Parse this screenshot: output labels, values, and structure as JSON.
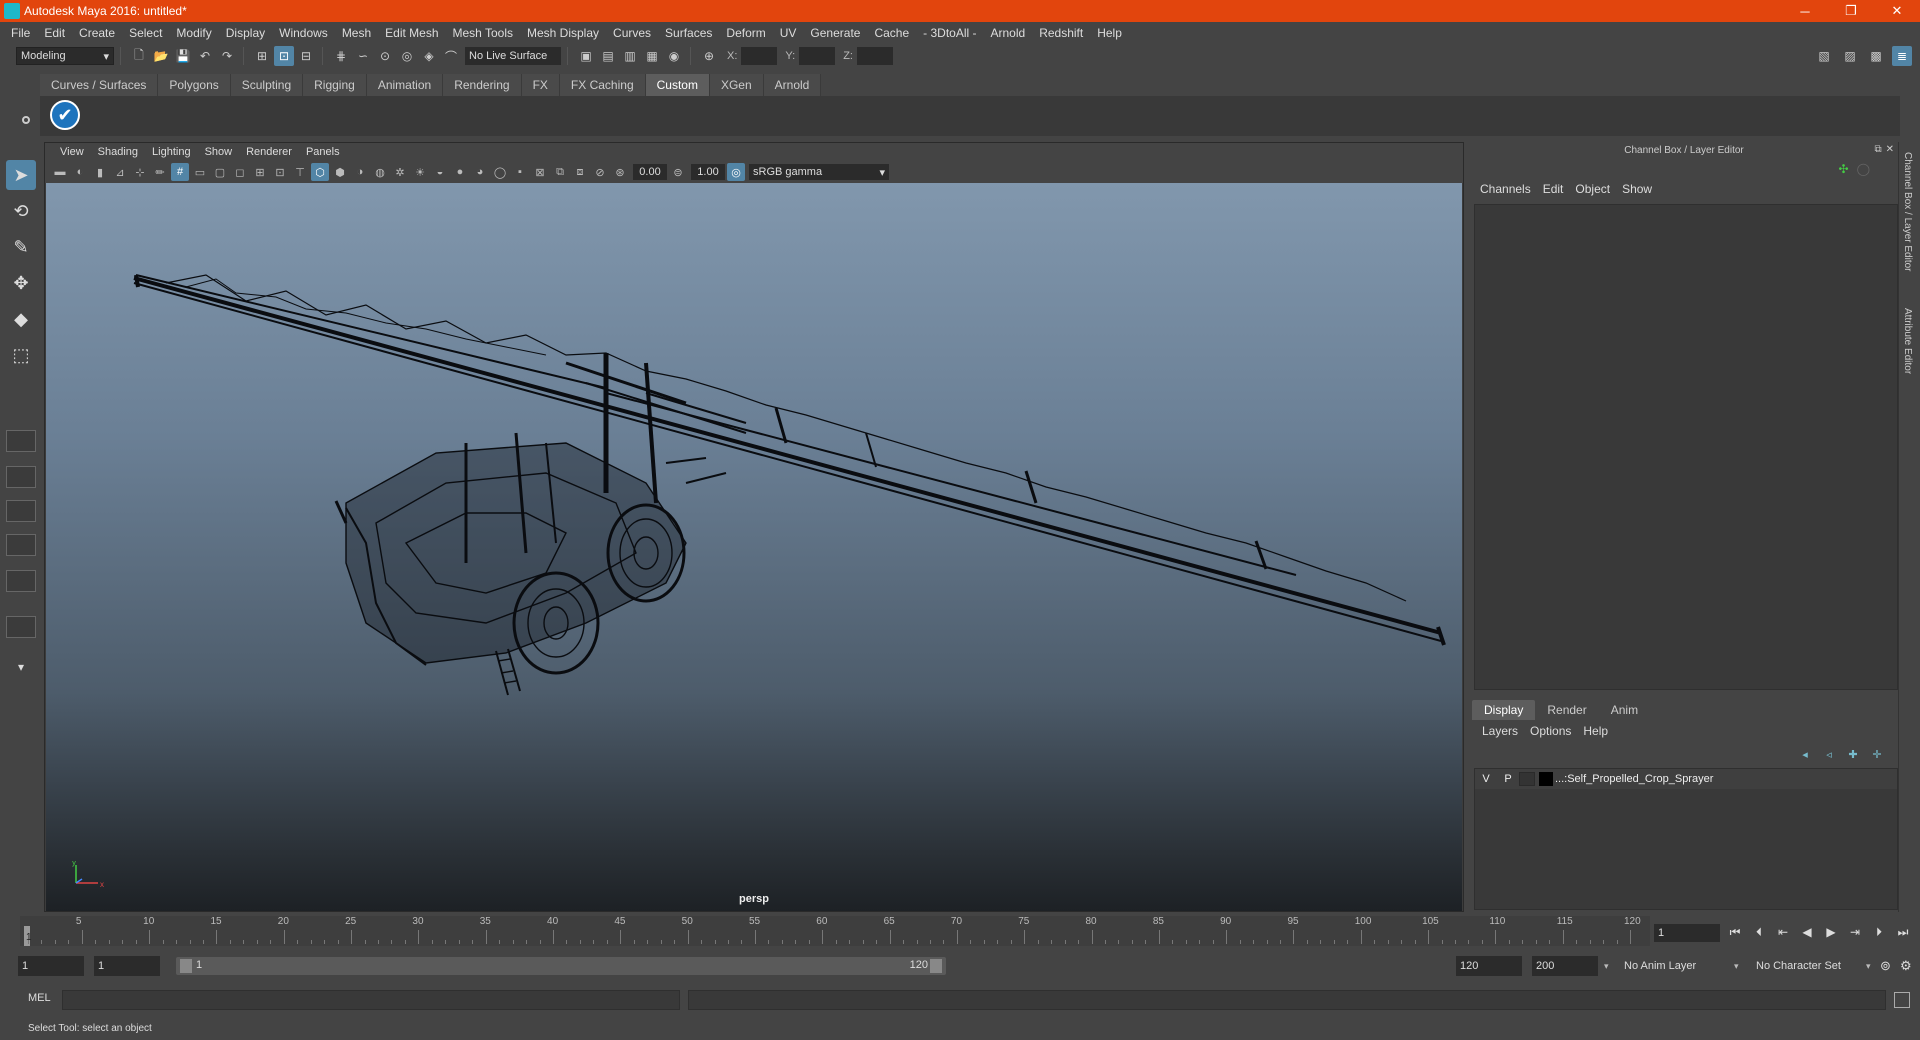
{
  "window": {
    "title": "Autodesk Maya 2016: untitled*",
    "minimize": "─",
    "restore": "❐",
    "close": "✕"
  },
  "menubar": [
    "File",
    "Edit",
    "Create",
    "Select",
    "Modify",
    "Display",
    "Windows",
    "Mesh",
    "Edit Mesh",
    "Mesh Tools",
    "Mesh Display",
    "Curves",
    "Surfaces",
    "Deform",
    "UV",
    "Generate",
    "Cache",
    "- 3DtoAll -",
    "Arnold",
    "Redshift",
    "Help"
  ],
  "statusline": {
    "mode": "Modeling",
    "live_surface": "No Live Surface",
    "x_label": "X:",
    "y_label": "Y:",
    "z_label": "Z:"
  },
  "shelf": {
    "tabs": [
      "Curves / Surfaces",
      "Polygons",
      "Sculpting",
      "Rigging",
      "Animation",
      "Rendering",
      "FX",
      "FX Caching",
      "Custom",
      "XGen",
      "Arnold"
    ],
    "active_tab": "Custom",
    "icon": "checkmark-shelf-icon"
  },
  "viewport": {
    "menus": [
      "View",
      "Shading",
      "Lighting",
      "Show",
      "Renderer",
      "Panels"
    ],
    "exposure": "0.00",
    "gamma": "1.00",
    "color_space": "sRGB gamma",
    "camera": "persp",
    "axis_x": "x",
    "axis_y": "y"
  },
  "right_panel": {
    "title": "Channel Box / Layer Editor",
    "menus": [
      "Channels",
      "Edit",
      "Object",
      "Show"
    ],
    "layer_tabs": [
      "Display",
      "Render",
      "Anim"
    ],
    "active_layer_tab": "Display",
    "layer_menus": [
      "Layers",
      "Options",
      "Help"
    ],
    "layer": {
      "visible": "V",
      "playback": "P",
      "name": "...:Self_Propelled_Crop_Sprayer"
    },
    "side_tabs": [
      "Channel Box / Layer Editor",
      "Attribute Editor"
    ]
  },
  "timeline": {
    "ticks": [
      "5",
      "10",
      "15",
      "20",
      "25",
      "30",
      "35",
      "40",
      "45",
      "50",
      "55",
      "60",
      "65",
      "70",
      "75",
      "80",
      "85",
      "90",
      "95",
      "100",
      "105",
      "110",
      "115",
      "120"
    ],
    "current": "1",
    "current_frame_field": "1"
  },
  "range": {
    "start": "1",
    "playback_start": "1",
    "slider_start": "1",
    "slider_end": "120",
    "playback_end": "120",
    "end": "200",
    "anim_layer": "No Anim Layer",
    "character_set": "No Character Set"
  },
  "command": {
    "label": "MEL"
  },
  "help": {
    "text": "Select Tool: select an object"
  },
  "colors": {
    "titlebar": "#e2450d",
    "accent": "#5285a6",
    "maya_teal": "#1fb8c9"
  }
}
